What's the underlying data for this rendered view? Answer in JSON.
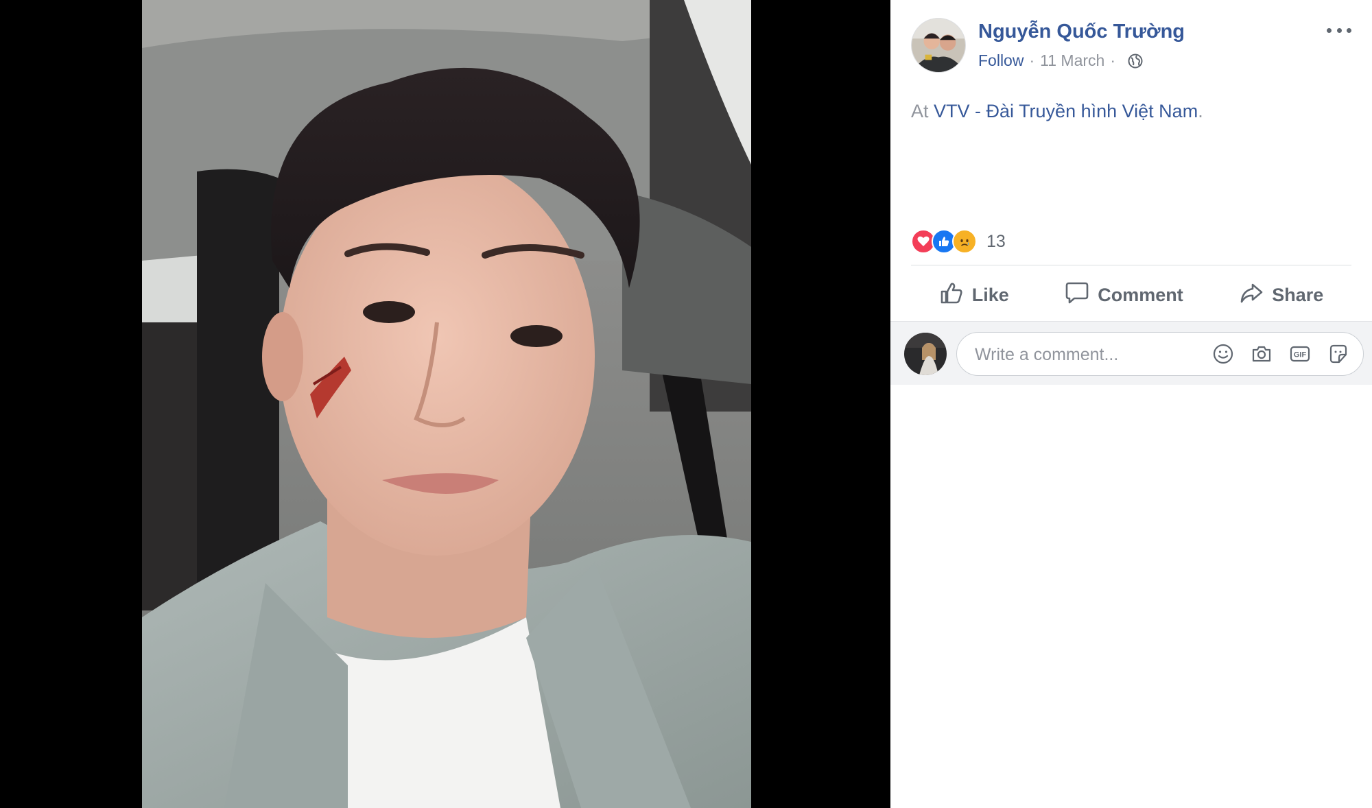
{
  "post": {
    "author": "Nguyễn Quốc Trường",
    "follow_label": "Follow",
    "separator": "·",
    "date": "11 March",
    "checkin_prefix": "At",
    "checkin_place": "VTV - Đài Truyền hình Việt Nam",
    "checkin_suffix": "."
  },
  "reactions": {
    "icons": [
      "love-icon",
      "like-icon",
      "sad-icon"
    ],
    "count": "13"
  },
  "actions": {
    "like_label": "Like",
    "comment_label": "Comment",
    "share_label": "Share"
  },
  "comment_box": {
    "placeholder": "Write a comment...",
    "gif_label": "GIF",
    "icons": [
      "emoji-icon",
      "camera-icon",
      "gif-icon",
      "sticker-icon"
    ]
  },
  "colors": {
    "link": "#365899",
    "secondary_text": "#90949c",
    "action_text": "#606770",
    "love": "#f33e58",
    "like": "#1877f2",
    "sad": "#f7b125",
    "viewer_bg": "#000000"
  }
}
